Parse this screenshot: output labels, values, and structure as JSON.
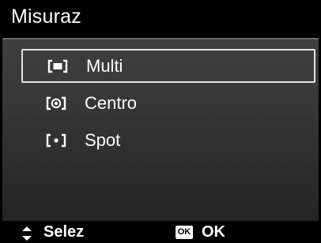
{
  "header": {
    "title": "Misuraz"
  },
  "menu": {
    "items": [
      {
        "label": "Multi",
        "icon": "metering-multi-icon",
        "selected": true
      },
      {
        "label": "Centro",
        "icon": "metering-center-icon",
        "selected": false
      },
      {
        "label": "Spot",
        "icon": "metering-spot-icon",
        "selected": false
      }
    ]
  },
  "footer": {
    "nav_icon": "up-down-arrows-icon",
    "nav_label": "Selez",
    "ok_icon_text": "OK",
    "ok_label": "OK"
  },
  "colors": {
    "background": "#000000",
    "panel_top": "#3e3e3e",
    "panel_bottom": "#242424",
    "selection_border": "#e6e6e6",
    "text": "#ffffff"
  }
}
